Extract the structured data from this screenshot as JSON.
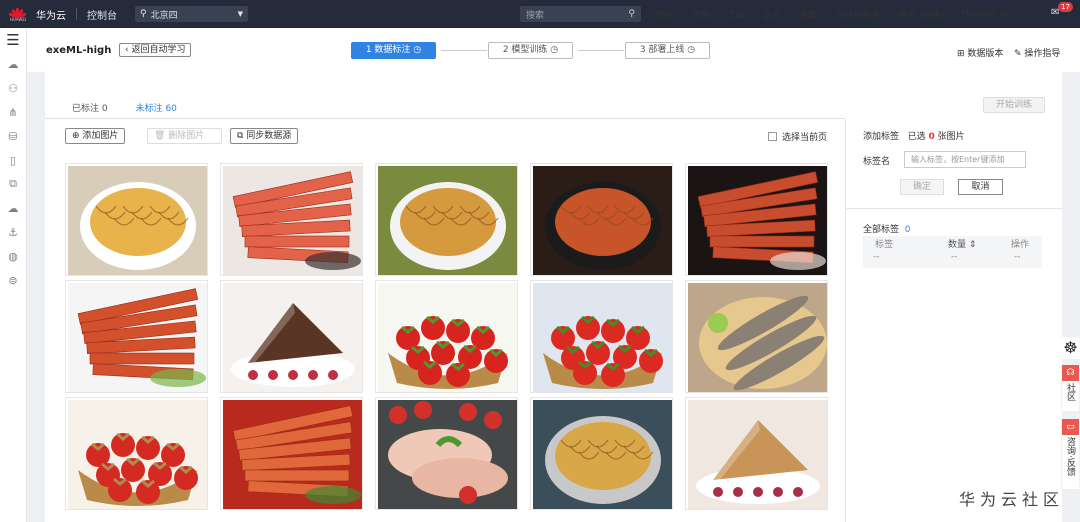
{
  "topbar": {
    "logo_text": "HUAWEI",
    "brand": "华为云",
    "console": "控制台",
    "region": "北京四",
    "search_placeholder": "搜索",
    "nav": [
      "费用",
      "资源",
      "工单",
      "企业",
      "备案",
      "支持与服务",
      "中文 (简体)",
      "Huawei_Bin"
    ],
    "badge": "17"
  },
  "header": {
    "project": "exeML-high",
    "back": "返回自动学习",
    "steps": [
      {
        "label": "1 数据标注",
        "active": true
      },
      {
        "label": "2 模型训练",
        "active": false
      },
      {
        "label": "3 部署上线",
        "active": false
      }
    ],
    "data_version": "数据版本",
    "guide": "操作指导"
  },
  "tabs": [
    {
      "label": "已标注 0",
      "active": false
    },
    {
      "label": "未标注 60",
      "active": true
    }
  ],
  "toolbar": {
    "add": "添加图片",
    "delete": "删除图片",
    "sync": "同步数据源",
    "select_page": "选择当前页",
    "train": "开始训练"
  },
  "images": [
    {
      "name": "instant-noodle-cup",
      "kind": "noodle",
      "bg": "#d8cdb8",
      "c1": "#e7b34a",
      "c2": "#ffffff"
    },
    {
      "name": "spicy-gluten-square",
      "kind": "strip",
      "bg": "#ece7e2",
      "c1": "#e2624a",
      "c2": "#3a3030"
    },
    {
      "name": "noodle-egg-bowl",
      "kind": "noodle",
      "bg": "#7a8a3e",
      "c1": "#d59a3e",
      "c2": "#f3f3f3"
    },
    {
      "name": "spicy-noodle-dark",
      "kind": "noodle",
      "bg": "#2a1c16",
      "c1": "#c8552a",
      "c2": "#1b1b1b"
    },
    {
      "name": "spicy-strips-hand",
      "kind": "strip",
      "bg": "#1a1414",
      "c1": "#c84d2e",
      "c2": "#e8d8d0"
    },
    {
      "name": "spicy-strips-plate",
      "kind": "strip",
      "bg": "#f5f5f5",
      "c1": "#d2502c",
      "c2": "#78b84a"
    },
    {
      "name": "chocolate-cake",
      "kind": "cake",
      "bg": "#f4f1ee",
      "c1": "#5a3424",
      "c2": "#c03040"
    },
    {
      "name": "strawberry-basket",
      "kind": "berry",
      "bg": "#f7f7f2",
      "c1": "#d8241e",
      "c2": "#4f9a30"
    },
    {
      "name": "strawberry-bowl",
      "kind": "berry",
      "bg": "#dfe6f0",
      "c1": "#db2a22",
      "c2": "#3f8e2a"
    },
    {
      "name": "grilled-fish",
      "kind": "fish",
      "bg": "#bda68a",
      "c1": "#8a8074",
      "c2": "#e6c88e"
    },
    {
      "name": "strawberry-wicker",
      "kind": "berry",
      "bg": "#f6f2ea",
      "c1": "#d42a22",
      "c2": "#b08a50"
    },
    {
      "name": "spicy-strips-pile",
      "kind": "strip",
      "bg": "#b82a1e",
      "c1": "#e0683a",
      "c2": "#3c8a30"
    },
    {
      "name": "chicken-breast",
      "kind": "chicken",
      "bg": "#444848",
      "c1": "#f0c8b8",
      "c2": "#d2302a"
    },
    {
      "name": "noodle-bowl-chopsticks",
      "kind": "noodle",
      "bg": "#3a4f5a",
      "c1": "#d8a848",
      "c2": "#c8c8c8"
    },
    {
      "name": "assorted-cake",
      "kind": "cake",
      "bg": "#f0e8e0",
      "c1": "#c89458",
      "c2": "#a83048"
    }
  ],
  "right": {
    "add_label": "添加标签",
    "selected_pre": "已选",
    "selected_count": "0",
    "selected_post": "张图片",
    "label_name": "标签名",
    "input_placeholder": "输入标签，按Enter键添加",
    "ok": "确定",
    "cancel": "取消",
    "all_labels": "全部标签",
    "all_count": "0",
    "col_label": "标签",
    "col_count": "数量",
    "col_ops": "操作",
    "empty": "--"
  },
  "float": {
    "community": "社区",
    "consult": "咨询·反馈"
  },
  "watermark": "华为云社区"
}
